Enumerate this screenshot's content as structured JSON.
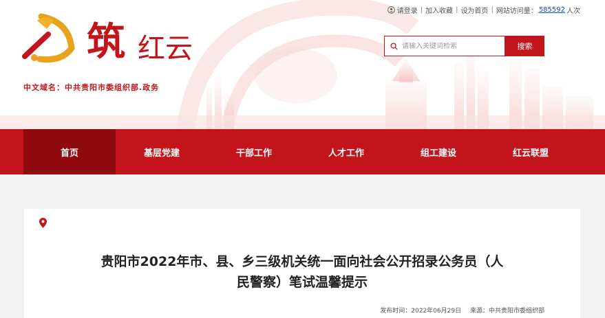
{
  "topbar": {
    "login": "请登录",
    "favorite": "加入收藏",
    "homepage": "设为首页",
    "visits_label": "网站访问量：",
    "visits_count": "585592",
    "visits_unit": "人次"
  },
  "brand": {
    "logo_glyph": "筑",
    "logo_text": "红云",
    "domain": "中文域名：中共贵阳市委组织部.政务"
  },
  "search": {
    "placeholder": "请输入关键词检索",
    "button": "搜索"
  },
  "nav": {
    "items": [
      {
        "label": "首页"
      },
      {
        "label": "基层党建"
      },
      {
        "label": "干部工作"
      },
      {
        "label": "人才工作"
      },
      {
        "label": "组工建设"
      },
      {
        "label": "红云联盟"
      }
    ]
  },
  "article": {
    "title": "贵阳市2022年市、县、乡三级机关统一面向社会公开招录公务员（人民警察）笔试温馨提示",
    "publish_label": "发布时间：",
    "publish_date": "2022年06月29日",
    "source_label": "来源：",
    "source": "中共贵阳市委组织部"
  },
  "colors": {
    "primary": "#c4141b",
    "nav_active": "#8e0a0f",
    "link_count": "#1b4fa8",
    "page_bg": "#f1f1f1"
  }
}
